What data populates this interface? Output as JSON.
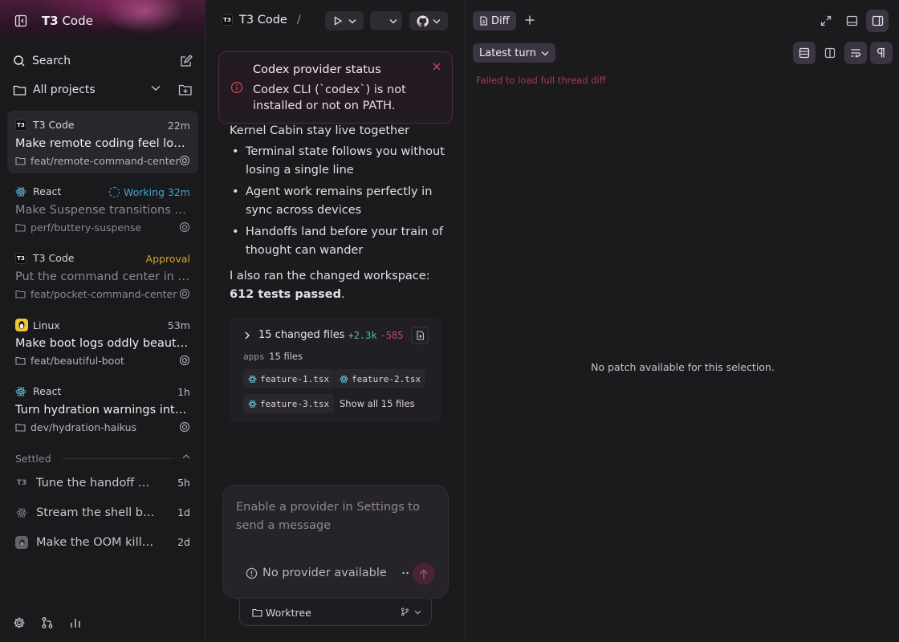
{
  "sidebar": {
    "brand_bold": "T3",
    "brand_rest": " Code",
    "search_label": "Search",
    "projects_label": "All projects",
    "threads": [
      {
        "project": "T3 Code",
        "time": "22m",
        "title": "Make remote coding feel local",
        "branch": "feat/remote-command-center",
        "icon": "t3-icon",
        "active": true
      },
      {
        "project": "React",
        "status": "Working",
        "time": "32m",
        "title": "Make Suspense transitions buttery",
        "branch": "perf/buttery-suspense",
        "icon": "react-icon"
      },
      {
        "project": "T3 Code",
        "status": "Approval",
        "title": "Put the command center in your pocket",
        "branch": "feat/pocket-command-center",
        "icon": "t3-icon"
      },
      {
        "project": "Linux",
        "time": "53m",
        "title": "Make boot logs oddly beautiful",
        "branch": "feat/beautiful-boot",
        "icon": "linux-icon"
      },
      {
        "project": "React",
        "time": "1h",
        "title": "Turn hydration warnings into haikus",
        "branch": "dev/hydration-haikus",
        "icon": "react-icon"
      }
    ],
    "settled_label": "Settled",
    "settled": [
      {
        "title": "Tune the handoff handshake",
        "time": "5h",
        "icon": "t3-icon"
      },
      {
        "title": "Stream the shell buffer",
        "time": "1d",
        "icon": "react-icon"
      },
      {
        "title": "Make the OOM killer kinder",
        "time": "2d",
        "icon": "linux-icon"
      }
    ]
  },
  "center": {
    "header_title": "T3 Code",
    "header_sep": "/",
    "toast": {
      "title": "Codex provider status",
      "body": "Codex CLI (`codex`) is not installed or not on PATH."
    },
    "msg_top": "Kernel Cabin stay live together",
    "bullets": [
      "Terminal state follows you without losing a single line",
      "Agent work remains perfectly in sync across devices",
      "Handoffs land before your train of thought can wander"
    ],
    "ran_text": "I also ran the changed workspace:",
    "tests_passed": "612 tests passed",
    "tests_period": ".",
    "files": {
      "summary": "15 changed files",
      "additions": "+2.3k",
      "deletions": "-585",
      "dir_name": "apps",
      "dir_count": "15 files",
      "chips": [
        "feature-1.tsx",
        "feature-2.tsx",
        "feature-3.tsx"
      ],
      "show_all": "Show all 15 files"
    },
    "composer_placeholder": "Enable a provider in Settings to send a message",
    "provider_label": "No provider available",
    "worktree_label": "Worktree"
  },
  "diff": {
    "tab_label": "Diff",
    "turn_label": "Latest turn",
    "error": "Failed to load full thread diff",
    "empty": "No patch available for this selection."
  },
  "colors": {
    "accent": "#4a2338",
    "working": "#3fa6d6",
    "approval": "#d9a42b",
    "additions": "#4cc58a",
    "deletions": "#c94863",
    "error": "#a63a5d"
  }
}
